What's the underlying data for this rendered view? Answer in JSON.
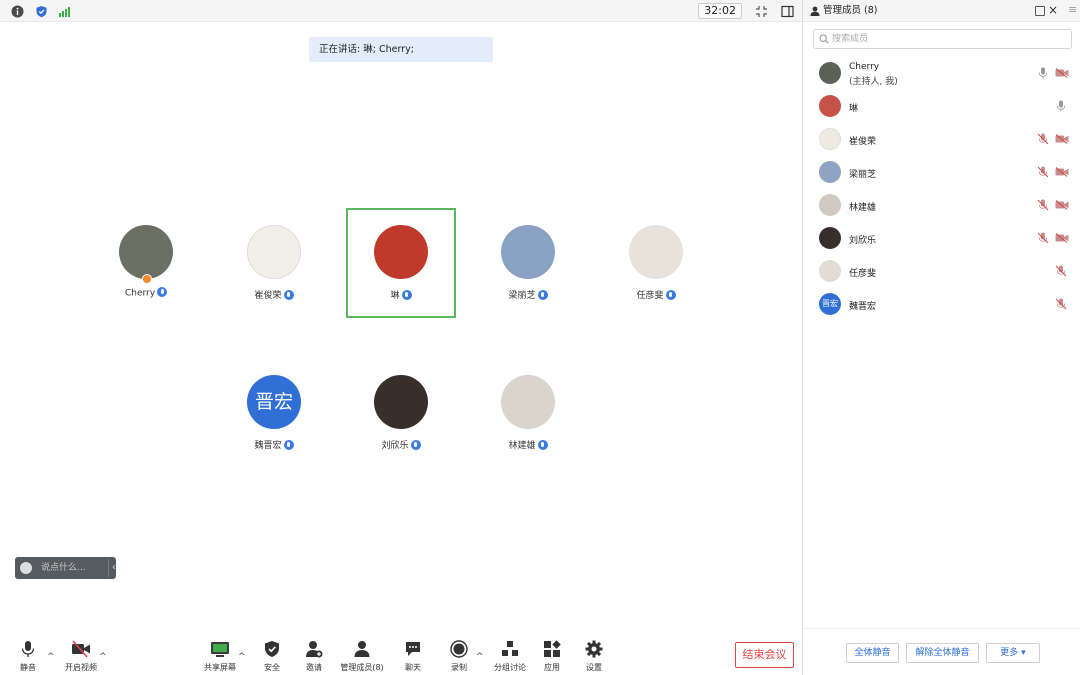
{
  "topbar": {
    "timer": "32:02",
    "icons": [
      "info-icon",
      "shield-icon",
      "signal-icon",
      "fullscreen-icon",
      "layout-icon"
    ]
  },
  "speaking": {
    "text": "正在讲话: 琳; Cherry;"
  },
  "tiles": [
    {
      "name": "Cherry",
      "avatar_color": "#6b6f63",
      "host": true
    },
    {
      "name": "崔俊荣",
      "avatar_color": "#f2efe9"
    },
    {
      "name": "琳",
      "avatar_color": "#c0392b",
      "active": true
    },
    {
      "name": "梁丽芝",
      "avatar_color": "#8aa3c4"
    },
    {
      "name": "任彦斐",
      "avatar_color": "#e9e2da"
    },
    {
      "name": "魏晋宏",
      "avatar_color": "#2f6fd6",
      "avatar_text": "晋宏"
    },
    {
      "name": "刘欣乐",
      "avatar_color": "#3a2e2b"
    },
    {
      "name": "林建雄",
      "avatar_color": "#d9d4cc"
    }
  ],
  "chat": {
    "placeholder": "说点什么...",
    "icons": [
      "smile-icon",
      "chevron-left-icon"
    ]
  },
  "toolbar": {
    "mute": "静音",
    "video": "开启视频",
    "share": "共享屏幕",
    "security": "安全",
    "invite": "邀请",
    "members": "管理成员(8)",
    "chat": "聊天",
    "record": "录制",
    "breakout": "分组讨论",
    "apps": "应用",
    "settings": "设置",
    "end": "结束会议"
  },
  "panel": {
    "title": "管理成员 (8)",
    "search_placeholder": "搜索成员",
    "members": [
      {
        "name": "Cherry",
        "sub": "(主持人, 我)",
        "avatar_color": "#5d6153"
      },
      {
        "name": "琳",
        "avatar_color": "#c6534a"
      },
      {
        "name": "崔俊荣",
        "avatar_color": "#eeeae2"
      },
      {
        "name": "梁丽芝",
        "avatar_color": "#8ea4c2"
      },
      {
        "name": "林建雄",
        "avatar_color": "#cfc9bf"
      },
      {
        "name": "刘欣乐",
        "avatar_color": "#3a2e2b"
      },
      {
        "name": "任彦斐",
        "avatar_color": "#e4dcd3"
      },
      {
        "name": "魏晋宏",
        "avatar_color": "#2f6fd6",
        "avatar_text": "晋宏"
      }
    ],
    "buttons": {
      "mute_all": "全体静音",
      "unmute_all": "解除全体静音",
      "more": "更多 ▾"
    }
  },
  "colors": {
    "accent": "#2f6fd6",
    "end": "#e04646",
    "active_border": "#5cb85c",
    "muted_mic": "#c98c8c"
  }
}
